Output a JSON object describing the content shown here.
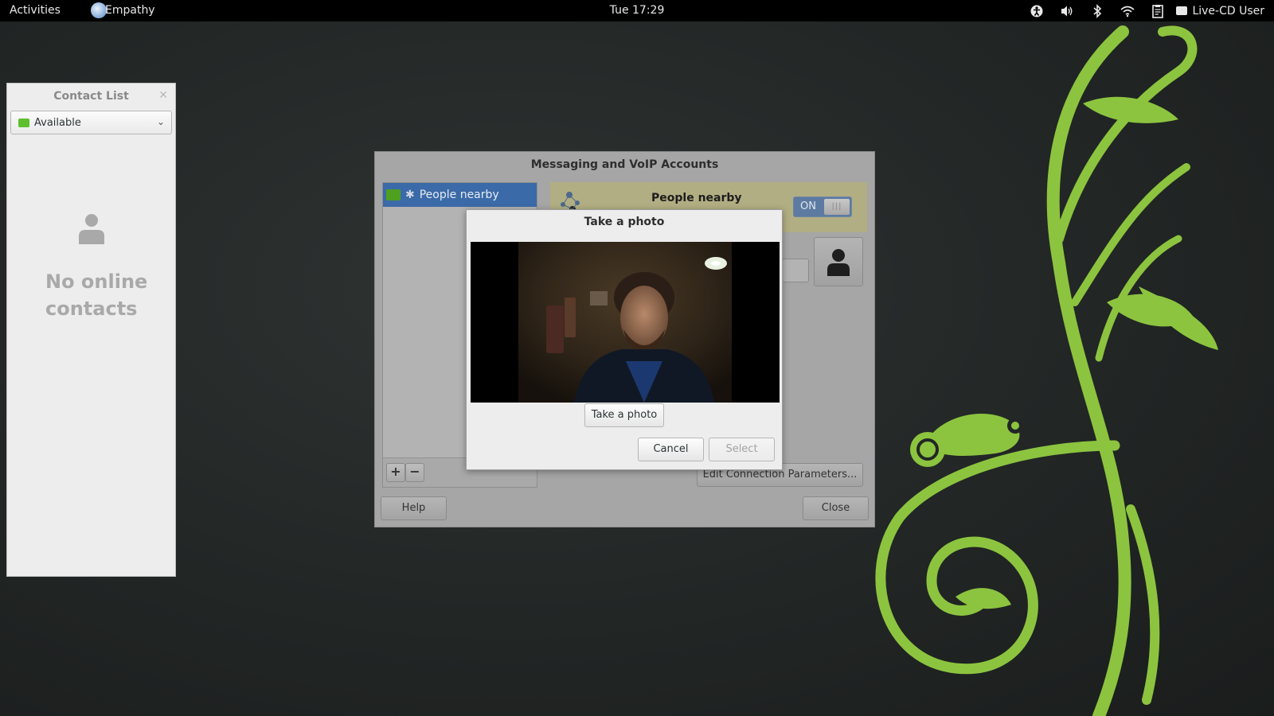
{
  "topbar": {
    "activities": "Activities",
    "app_name": "Empathy",
    "clock": "Tue 17:29",
    "user": "Live-CD User",
    "icons": [
      "accessibility-icon",
      "volume-icon",
      "bluetooth-icon",
      "wifi-icon",
      "clipboard-icon",
      "chat-icon"
    ]
  },
  "contact_list": {
    "title": "Contact List",
    "status": "Available",
    "empty_message": "No online contacts"
  },
  "accounts_dialog": {
    "title": "Messaging and VoIP Accounts",
    "accounts": [
      {
        "name": "People nearby",
        "selected": true
      }
    ],
    "header_name": "People nearby",
    "toggle": "ON",
    "edit_button": "Edit Connection Parameters...",
    "help_button": "Help",
    "close_button": "Close",
    "add_label": "+",
    "remove_label": "−"
  },
  "photo_dialog": {
    "title": "Take a photo",
    "take_button": "Take a photo",
    "cancel_button": "Cancel",
    "select_button": "Select"
  },
  "colors": {
    "wallpaper_vine": "#8cc43f",
    "selection": "#3b6aa8"
  }
}
